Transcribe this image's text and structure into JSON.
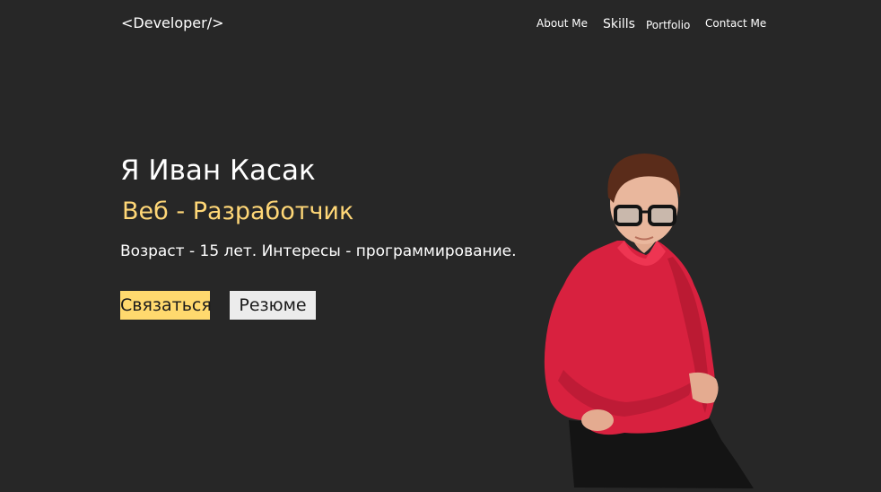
{
  "header": {
    "logo": "<Developer/>",
    "nav": {
      "about": "About Me",
      "skills": "Skills",
      "portfolio": "Portfolio",
      "contact": "Contact Me"
    }
  },
  "hero": {
    "name": "Я Иван Касак",
    "role": "Веб - Разработчик",
    "description": "Возраст - 15 лет. Интересы - программирование.",
    "contact_button": "Связаться",
    "resume_button": "Резюме"
  },
  "colors": {
    "background": "#272727",
    "accent": "#ffd777",
    "contact_button": "#ffd96e",
    "resume_button": "#ececec",
    "shirt": "#d8213f"
  }
}
